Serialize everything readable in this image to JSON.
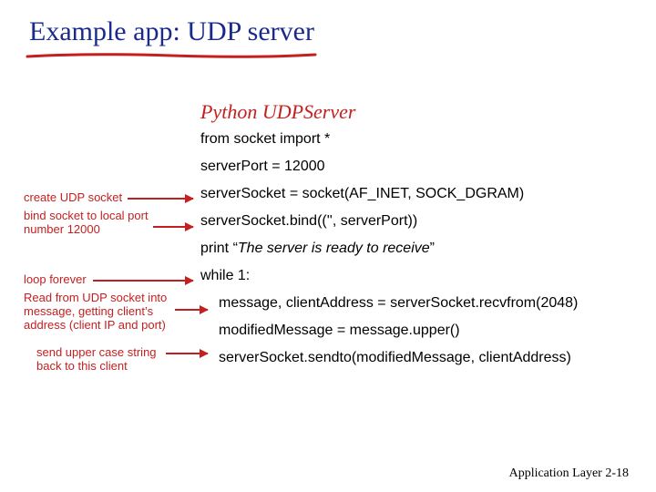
{
  "title": "Example app: UDP server",
  "subtitle": "Python UDPServer",
  "code": {
    "l1": "from socket import *",
    "l2": "serverPort = 12000",
    "l3": "serverSocket = socket(AF_INET, SOCK_DGRAM)",
    "l4": "serverSocket.bind(('', serverPort))",
    "l5a": "print “",
    "l5b": "The server is ready to receive",
    "l5c": "”",
    "l6": "while 1:",
    "l7": "message, clientAddress = serverSocket.recvfrom(2048)",
    "l8": "modifiedMessage = message.upper()",
    "l9": "serverSocket.sendto(modifiedMessage, clientAddress)"
  },
  "annot": {
    "a1": "create UDP socket",
    "a2": "bind socket to local port number 12000",
    "a3": "loop forever",
    "a4": "Read from UDP socket into message, getting client’s address (client IP and port)",
    "a5": "send upper case string back to this client"
  },
  "footer": {
    "left": "Application Layer",
    "right": "2-18"
  }
}
